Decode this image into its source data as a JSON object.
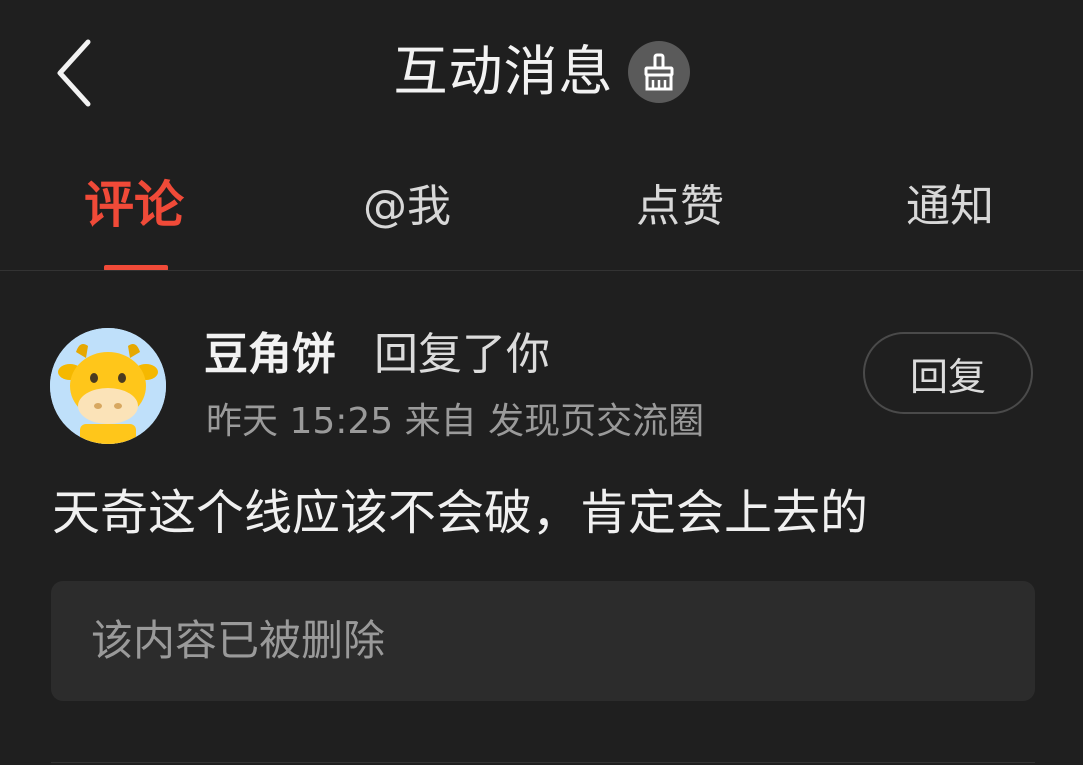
{
  "header": {
    "title": "互动消息",
    "back_icon": "chevron-left-icon",
    "clear_icon": "broom-icon"
  },
  "tabs": [
    {
      "label": "评论",
      "active": true
    },
    {
      "label": "@我",
      "active": false
    },
    {
      "label": "点赞",
      "active": false
    },
    {
      "label": "通知",
      "active": false
    }
  ],
  "colors": {
    "accent": "#f04a38",
    "background": "#1f1f1f",
    "quote_background": "#2c2c2c"
  },
  "messages": [
    {
      "username": "豆角饼",
      "action": "回复了你",
      "meta": "昨天 15:25 来自 发现页交流圈",
      "reply_label": "回复",
      "comment": "天奇这个线应该不会破，肯定会上去的",
      "quote": "该内容已被删除",
      "avatar_icon": "cartoon-cow-avatar"
    }
  ]
}
